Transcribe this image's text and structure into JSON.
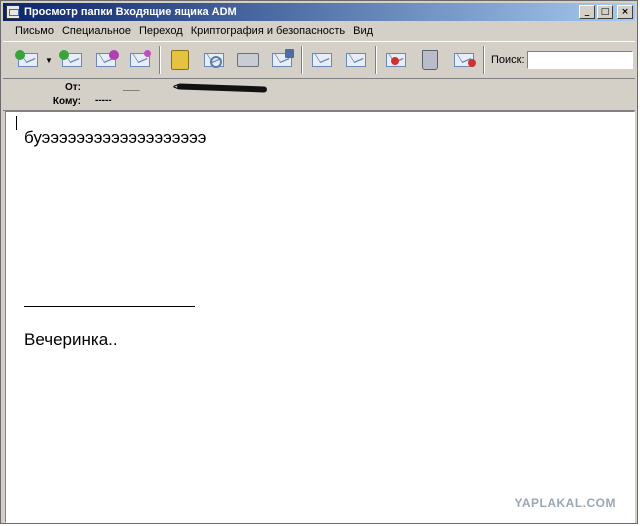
{
  "window": {
    "title": "Просмотр папки Входящие ящика ADM",
    "minimize": "_",
    "maximize": "□",
    "close": "×"
  },
  "menu": [
    "Письмо",
    "Специальное",
    "Переход",
    "Криптография и безопасность",
    "Вид"
  ],
  "toolbar": {
    "icons": [
      "get-mail-icon",
      "reply-icon",
      "forward-icon",
      "new-message-icon",
      "address-book-icon",
      "find-icon",
      "print-icon",
      "save-icon",
      "move-icon",
      "copy-icon",
      "delete-mark-icon",
      "trash-icon",
      "junk-icon"
    ],
    "search_label": "Поиск:",
    "search_value": ""
  },
  "header": {
    "from_label": "От:",
    "from_value": "___",
    "from_addr": "<",
    "to_label": "Кому:",
    "to_value": "-----"
  },
  "message": {
    "line1": "буэээээээээээээээээээ",
    "signature": "Вечеринка.."
  },
  "watermark": "YAPLAKAL.COM"
}
